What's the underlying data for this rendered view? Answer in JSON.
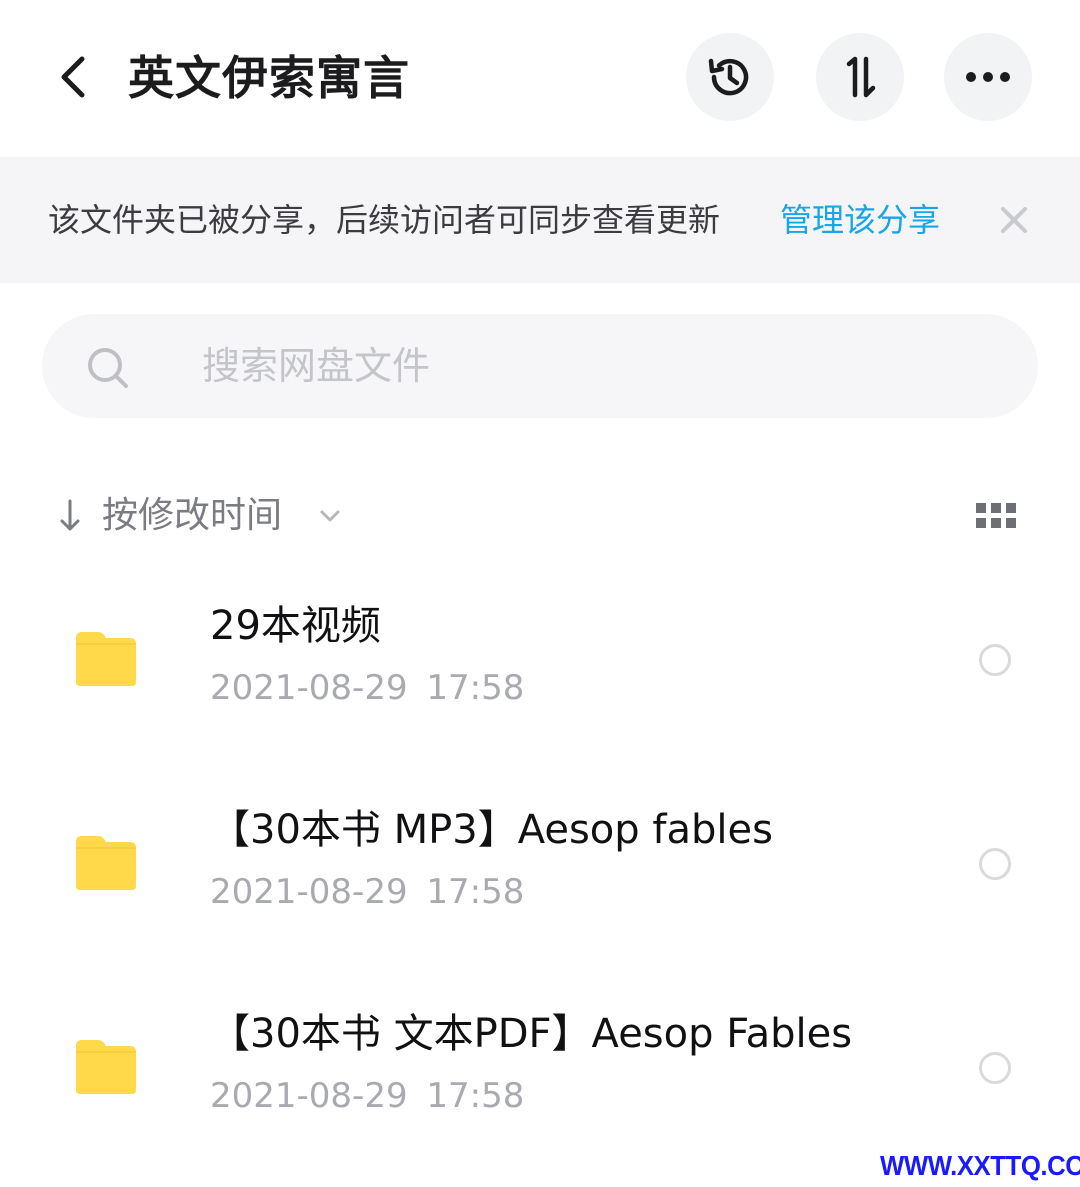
{
  "header": {
    "title": "英文伊索寓言",
    "back_icon": "chevron-left-icon",
    "history_icon": "history-icon",
    "sort_icon": "sort-up-down-icon",
    "more_icon": "more-horizontal-icon"
  },
  "banner": {
    "text": "该文件夹已被分享，后续访问者可同步查看更新",
    "link": "管理该分享",
    "close_icon": "close-icon"
  },
  "search": {
    "placeholder": "搜索网盘文件",
    "icon": "search-icon"
  },
  "sortbar": {
    "label": "按修改时间",
    "arrow_icon": "arrow-down-icon",
    "chevron_icon": "chevron-down-icon",
    "view_toggle_icon": "grid-view-icon"
  },
  "files": [
    {
      "name": "29本视频",
      "date": "2021-08-29  17:58",
      "icon": "folder-icon"
    },
    {
      "name": "【30本书 MP3】Aesop fables",
      "date": "2021-08-29  17:58",
      "icon": "folder-icon"
    },
    {
      "name": "【30本书 文本PDF】Aesop Fables",
      "date": "2021-08-29  17:58",
      "icon": "folder-icon"
    }
  ],
  "watermark": "WWW.XXTTQ.COM",
  "colors": {
    "accent": "#1aa5e6",
    "folder": "#ffd94a",
    "banner_bg": "#f5f5f7",
    "watermark": "#1a1aff"
  }
}
